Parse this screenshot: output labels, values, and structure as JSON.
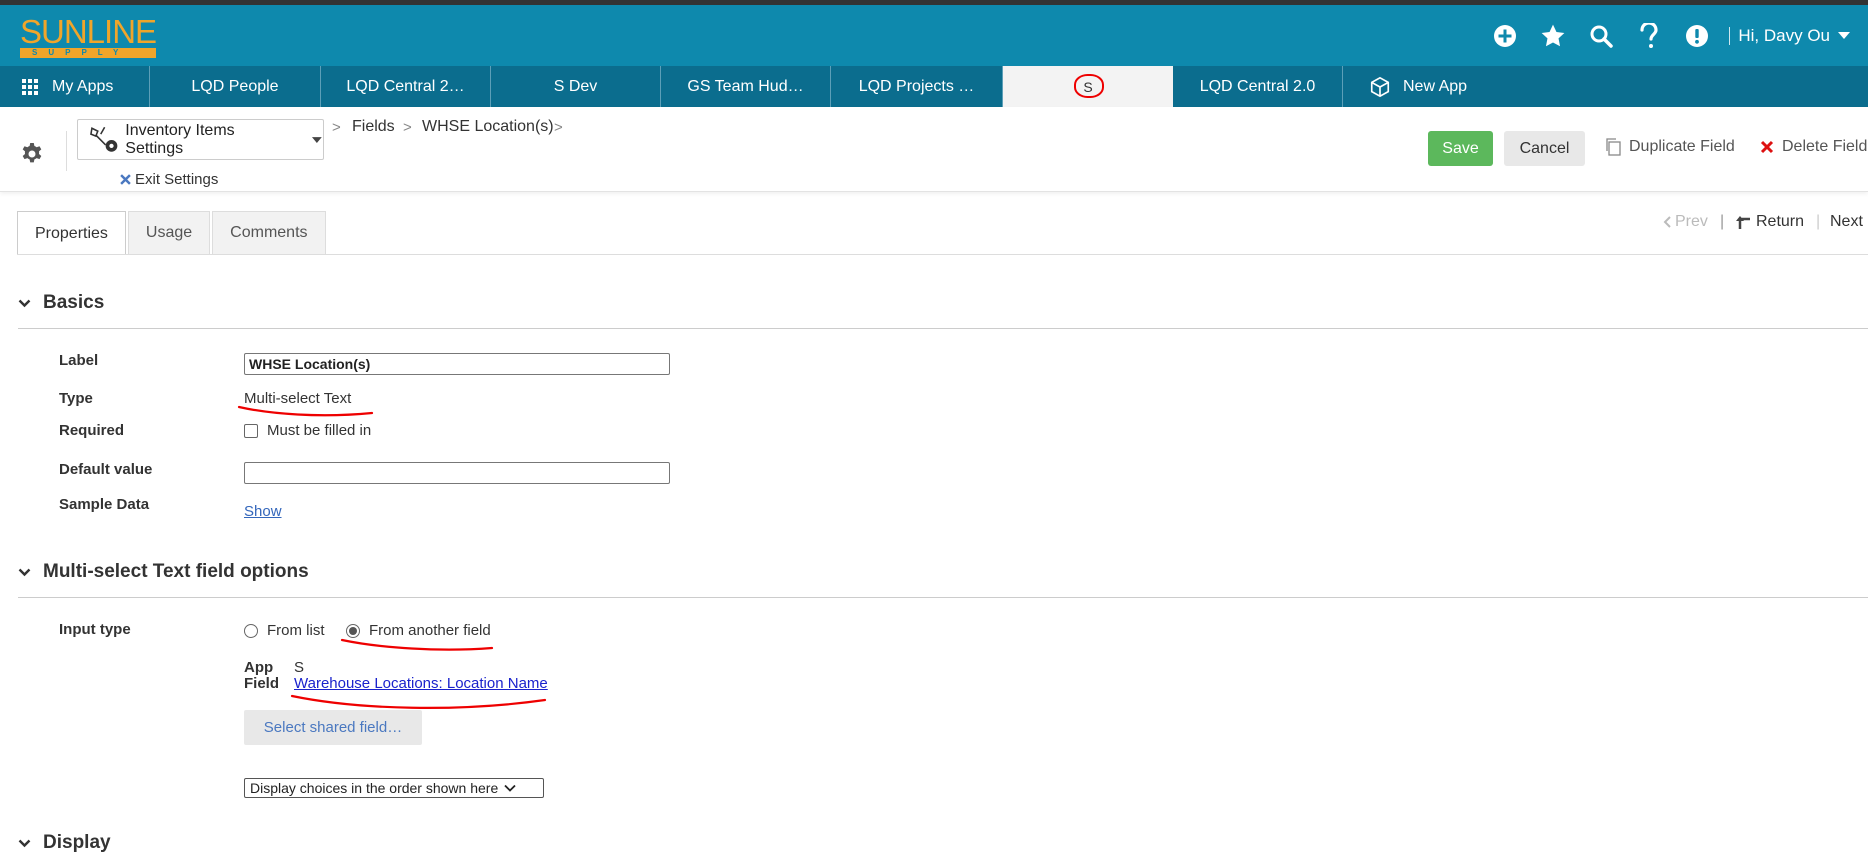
{
  "header": {
    "logo_main": "SUNLINE",
    "logo_sub": "SUPPLY",
    "user_greeting": "Hi, Davy Ou"
  },
  "app_tabs": [
    {
      "label": "My Apps"
    },
    {
      "label": "LQD People"
    },
    {
      "label": "LQD Central 2…"
    },
    {
      "label": "S Dev"
    },
    {
      "label": "GS Team Hud…"
    },
    {
      "label": "LQD Projects …"
    },
    {
      "label": "S"
    },
    {
      "label": "LQD Central 2.0"
    },
    {
      "label": "New App"
    }
  ],
  "toolbar": {
    "settings_dropdown": "Inventory Items Settings",
    "breadcrumb": [
      "Fields",
      "WHSE Location(s)"
    ],
    "exit_settings": "Exit Settings",
    "save": "Save",
    "cancel": "Cancel",
    "duplicate": "Duplicate Field",
    "delete": "Delete Field"
  },
  "page_tabs": [
    "Properties",
    "Usage",
    "Comments"
  ],
  "record_nav": {
    "prev": "Prev",
    "return": "Return",
    "next": "Next"
  },
  "basics": {
    "title": "Basics",
    "label_label": "Label",
    "label_value": "WHSE Location(s)",
    "type_label": "Type",
    "type_value": "Multi-select Text",
    "required_label": "Required",
    "required_text": "Must be filled in",
    "default_label": "Default value",
    "default_value": "",
    "sample_label": "Sample Data",
    "sample_link": "Show"
  },
  "options": {
    "title": "Multi-select Text field options",
    "input_type_label": "Input type",
    "radio_list": "From list",
    "radio_field": "From another field",
    "app_label": "App",
    "app_value": "S",
    "field_label": "Field",
    "field_value": "Warehouse Locations: Location Name",
    "select_shared": "Select shared field…",
    "order_select": "Display choices in the order shown here"
  },
  "display": {
    "title": "Display"
  },
  "colors": {
    "header_bg": "#0e89ad",
    "tabbar_bg": "#0b6d8e",
    "logo": "#f0a52a",
    "save_btn": "#5cb85c",
    "annotation": "#e00000"
  }
}
